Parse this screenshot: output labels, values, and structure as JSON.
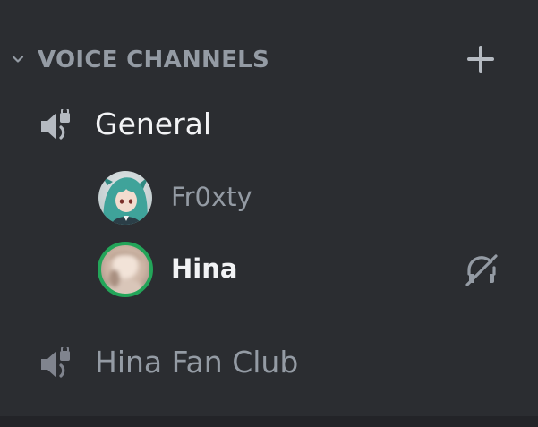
{
  "category": {
    "label": "VOICE CHANNELS",
    "collapse_icon": "chevron-down-icon",
    "add_icon": "plus-icon"
  },
  "channels": [
    {
      "name": "General",
      "icon": "speaker-lock-icon",
      "users": [
        {
          "name": "Fr0xty",
          "avatar": "anime-avatar",
          "speaking": false,
          "status_icon": ""
        },
        {
          "name": "Hina",
          "avatar": "blurred-photo-avatar",
          "speaking": true,
          "status_icon": "deafened-headphones-icon"
        }
      ]
    },
    {
      "name": "Hina Fan Club",
      "icon": "speaker-lock-icon",
      "users": []
    }
  ],
  "colors": {
    "background": "#2b2d31",
    "muted_text": "#949ba4",
    "active_text": "#f2f3f5",
    "speaking_ring": "#23a559"
  }
}
